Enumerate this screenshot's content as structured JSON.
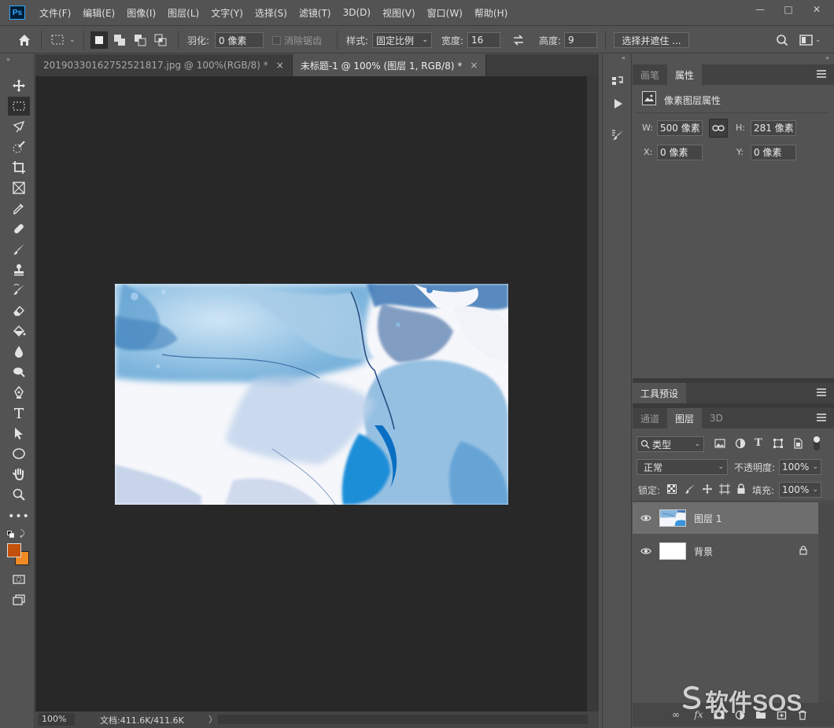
{
  "app": {
    "logo_text": "Ps"
  },
  "menu": [
    "文件(F)",
    "编辑(E)",
    "图像(I)",
    "图层(L)",
    "文字(Y)",
    "选择(S)",
    "滤镜(T)",
    "3D(D)",
    "视图(V)",
    "窗口(W)",
    "帮助(H)"
  ],
  "window_controls": {
    "minimize": "—",
    "maximize": "□",
    "close": "✕"
  },
  "options": {
    "feather_label": "羽化:",
    "feather_value": "0 像素",
    "antialias_label": "消除锯齿",
    "style_label": "样式:",
    "style_value": "固定比例",
    "width_label": "宽度:",
    "width_value": "16",
    "height_label": "高度:",
    "height_value": "9",
    "select_mask_button": "选择并遮住 ..."
  },
  "tabs": [
    {
      "label": "20190330162752521817.jpg @ 100%(RGB/8) *",
      "close": "×",
      "active": false
    },
    {
      "label": "未标题-1 @ 100% (图层 1, RGB/8) *",
      "close": "×",
      "active": true
    }
  ],
  "status": {
    "zoom": "100%",
    "doc_info": "文档:411.6K/411.6K",
    "arrow": "〉"
  },
  "colors": {
    "foreground": "#c4510a",
    "background": "#f08a24",
    "accent": "#31a8ff"
  },
  "properties_panel": {
    "tabs": [
      {
        "label": "画笔",
        "active": false
      },
      {
        "label": "属性",
        "active": true
      }
    ],
    "heading": "像素图层属性",
    "w_label": "W:",
    "w_value": "500 像素",
    "h_label": "H:",
    "h_value": "281 像素",
    "x_label": "X:",
    "x_value": "0 像素",
    "y_label": "Y:",
    "y_value": "0 像素"
  },
  "tool_presets": {
    "tab_label": "工具预设"
  },
  "layers_panel": {
    "tabs": [
      {
        "label": "通道",
        "active": false
      },
      {
        "label": "图层",
        "active": true
      },
      {
        "label": "3D",
        "active": false
      }
    ],
    "filter_kind": "类型",
    "blend_mode": "正常",
    "opacity_label": "不透明度:",
    "opacity_value": "100%",
    "lock_label": "锁定:",
    "fill_label": "填充:",
    "fill_value": "100%",
    "layers": [
      {
        "name": "图层 1",
        "selected": true,
        "locked": false
      },
      {
        "name": "背景",
        "selected": false,
        "locked": true
      }
    ]
  },
  "watermark": {
    "text": "软件SOS"
  }
}
